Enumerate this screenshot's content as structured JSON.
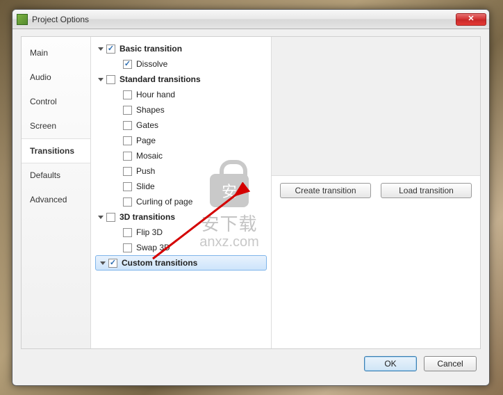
{
  "window": {
    "title": "Project Options"
  },
  "sidebar": {
    "items": [
      {
        "label": "Main",
        "active": false
      },
      {
        "label": "Audio",
        "active": false
      },
      {
        "label": "Control",
        "active": false
      },
      {
        "label": "Screen",
        "active": false
      },
      {
        "label": "Transitions",
        "active": true
      },
      {
        "label": "Defaults",
        "active": false
      },
      {
        "label": "Advanced",
        "active": false
      }
    ]
  },
  "tree": [
    {
      "indent": 0,
      "expander": true,
      "checked": true,
      "bold": true,
      "label": "Basic transition",
      "selected": false
    },
    {
      "indent": 1,
      "expander": false,
      "checked": true,
      "bold": false,
      "label": "Dissolve",
      "selected": false
    },
    {
      "indent": 0,
      "expander": true,
      "checked": false,
      "bold": true,
      "label": "Standard transitions",
      "selected": false
    },
    {
      "indent": 1,
      "expander": false,
      "checked": false,
      "bold": false,
      "label": "Hour hand",
      "selected": false
    },
    {
      "indent": 1,
      "expander": false,
      "checked": false,
      "bold": false,
      "label": "Shapes",
      "selected": false
    },
    {
      "indent": 1,
      "expander": false,
      "checked": false,
      "bold": false,
      "label": "Gates",
      "selected": false
    },
    {
      "indent": 1,
      "expander": false,
      "checked": false,
      "bold": false,
      "label": "Page",
      "selected": false
    },
    {
      "indent": 1,
      "expander": false,
      "checked": false,
      "bold": false,
      "label": "Mosaic",
      "selected": false
    },
    {
      "indent": 1,
      "expander": false,
      "checked": false,
      "bold": false,
      "label": "Push",
      "selected": false
    },
    {
      "indent": 1,
      "expander": false,
      "checked": false,
      "bold": false,
      "label": "Slide",
      "selected": false
    },
    {
      "indent": 1,
      "expander": false,
      "checked": false,
      "bold": false,
      "label": "Curling of page",
      "selected": false
    },
    {
      "indent": 0,
      "expander": true,
      "checked": false,
      "bold": true,
      "label": "3D transitions",
      "selected": false
    },
    {
      "indent": 1,
      "expander": false,
      "checked": false,
      "bold": false,
      "label": "Flip 3D",
      "selected": false
    },
    {
      "indent": 1,
      "expander": false,
      "checked": false,
      "bold": false,
      "label": "Swap 3D",
      "selected": false
    },
    {
      "indent": 0,
      "expander": true,
      "checked": true,
      "bold": true,
      "label": "Custom transitions",
      "selected": true
    }
  ],
  "right": {
    "create_label": "Create transition",
    "load_label": "Load transition"
  },
  "dialog": {
    "ok_label": "OK",
    "cancel_label": "Cancel"
  },
  "watermark": {
    "line1": "安下载",
    "line2": "anxz.com"
  }
}
